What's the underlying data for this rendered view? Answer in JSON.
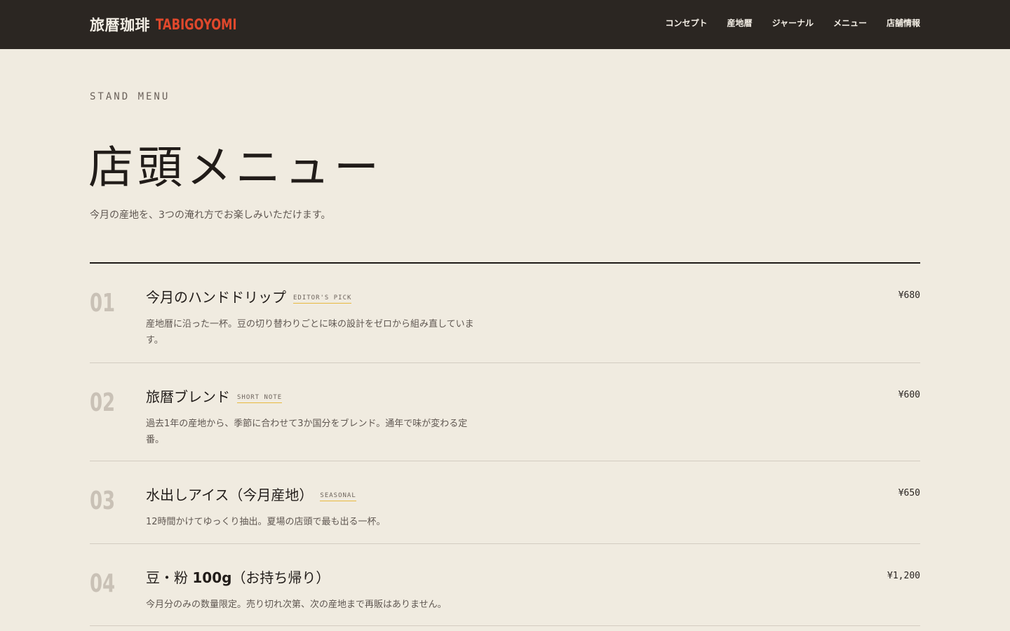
{
  "header": {
    "brand_jp": "旅暦珈琲",
    "brand_en": "TABIGOYOMI",
    "nav": [
      "コンセプト",
      "産地暦",
      "ジャーナル",
      "メニュー",
      "店舗情報"
    ]
  },
  "hero": {
    "eyebrow": "STAND MENU",
    "title": "店頭メニュー",
    "lead": "今月の産地を、3つの淹れ方でお楽しみいただけます。"
  },
  "menu": [
    {
      "num": "01",
      "name": "今月のハンドドリップ",
      "tag": "EDITOR'S PICK",
      "desc": "産地暦に沿った一杯。豆の切り替わりごとに味の設計をゼロから組み直しています。",
      "price": "¥680"
    },
    {
      "num": "02",
      "name": "旅暦ブレンド",
      "tag": "SHORT NOTE",
      "desc": "過去1年の産地から、季節に合わせて3か国分をブレンド。通年で味が変わる定番。",
      "price": "¥600"
    },
    {
      "num": "03",
      "name": "水出しアイス（今月産地）",
      "tag": "SEASONAL",
      "desc": "12時間かけてゆっくり抽出。夏場の店頭で最も出る一杯。",
      "price": "¥650"
    },
    {
      "num": "04",
      "name_pre": "豆・粉 ",
      "name_bold": "100g",
      "name_post": "（お持ち帰り）",
      "tag": "",
      "desc": "今月分のみの数量限定。売り切れ次第、次の産地まで再販はありません。",
      "price": "¥1,200"
    }
  ],
  "colors": {
    "header_bg": "#2b2622",
    "page_bg": "#f0ebe0",
    "brand_accent": "#e0482c",
    "tag_underline": "#e8b93f"
  }
}
